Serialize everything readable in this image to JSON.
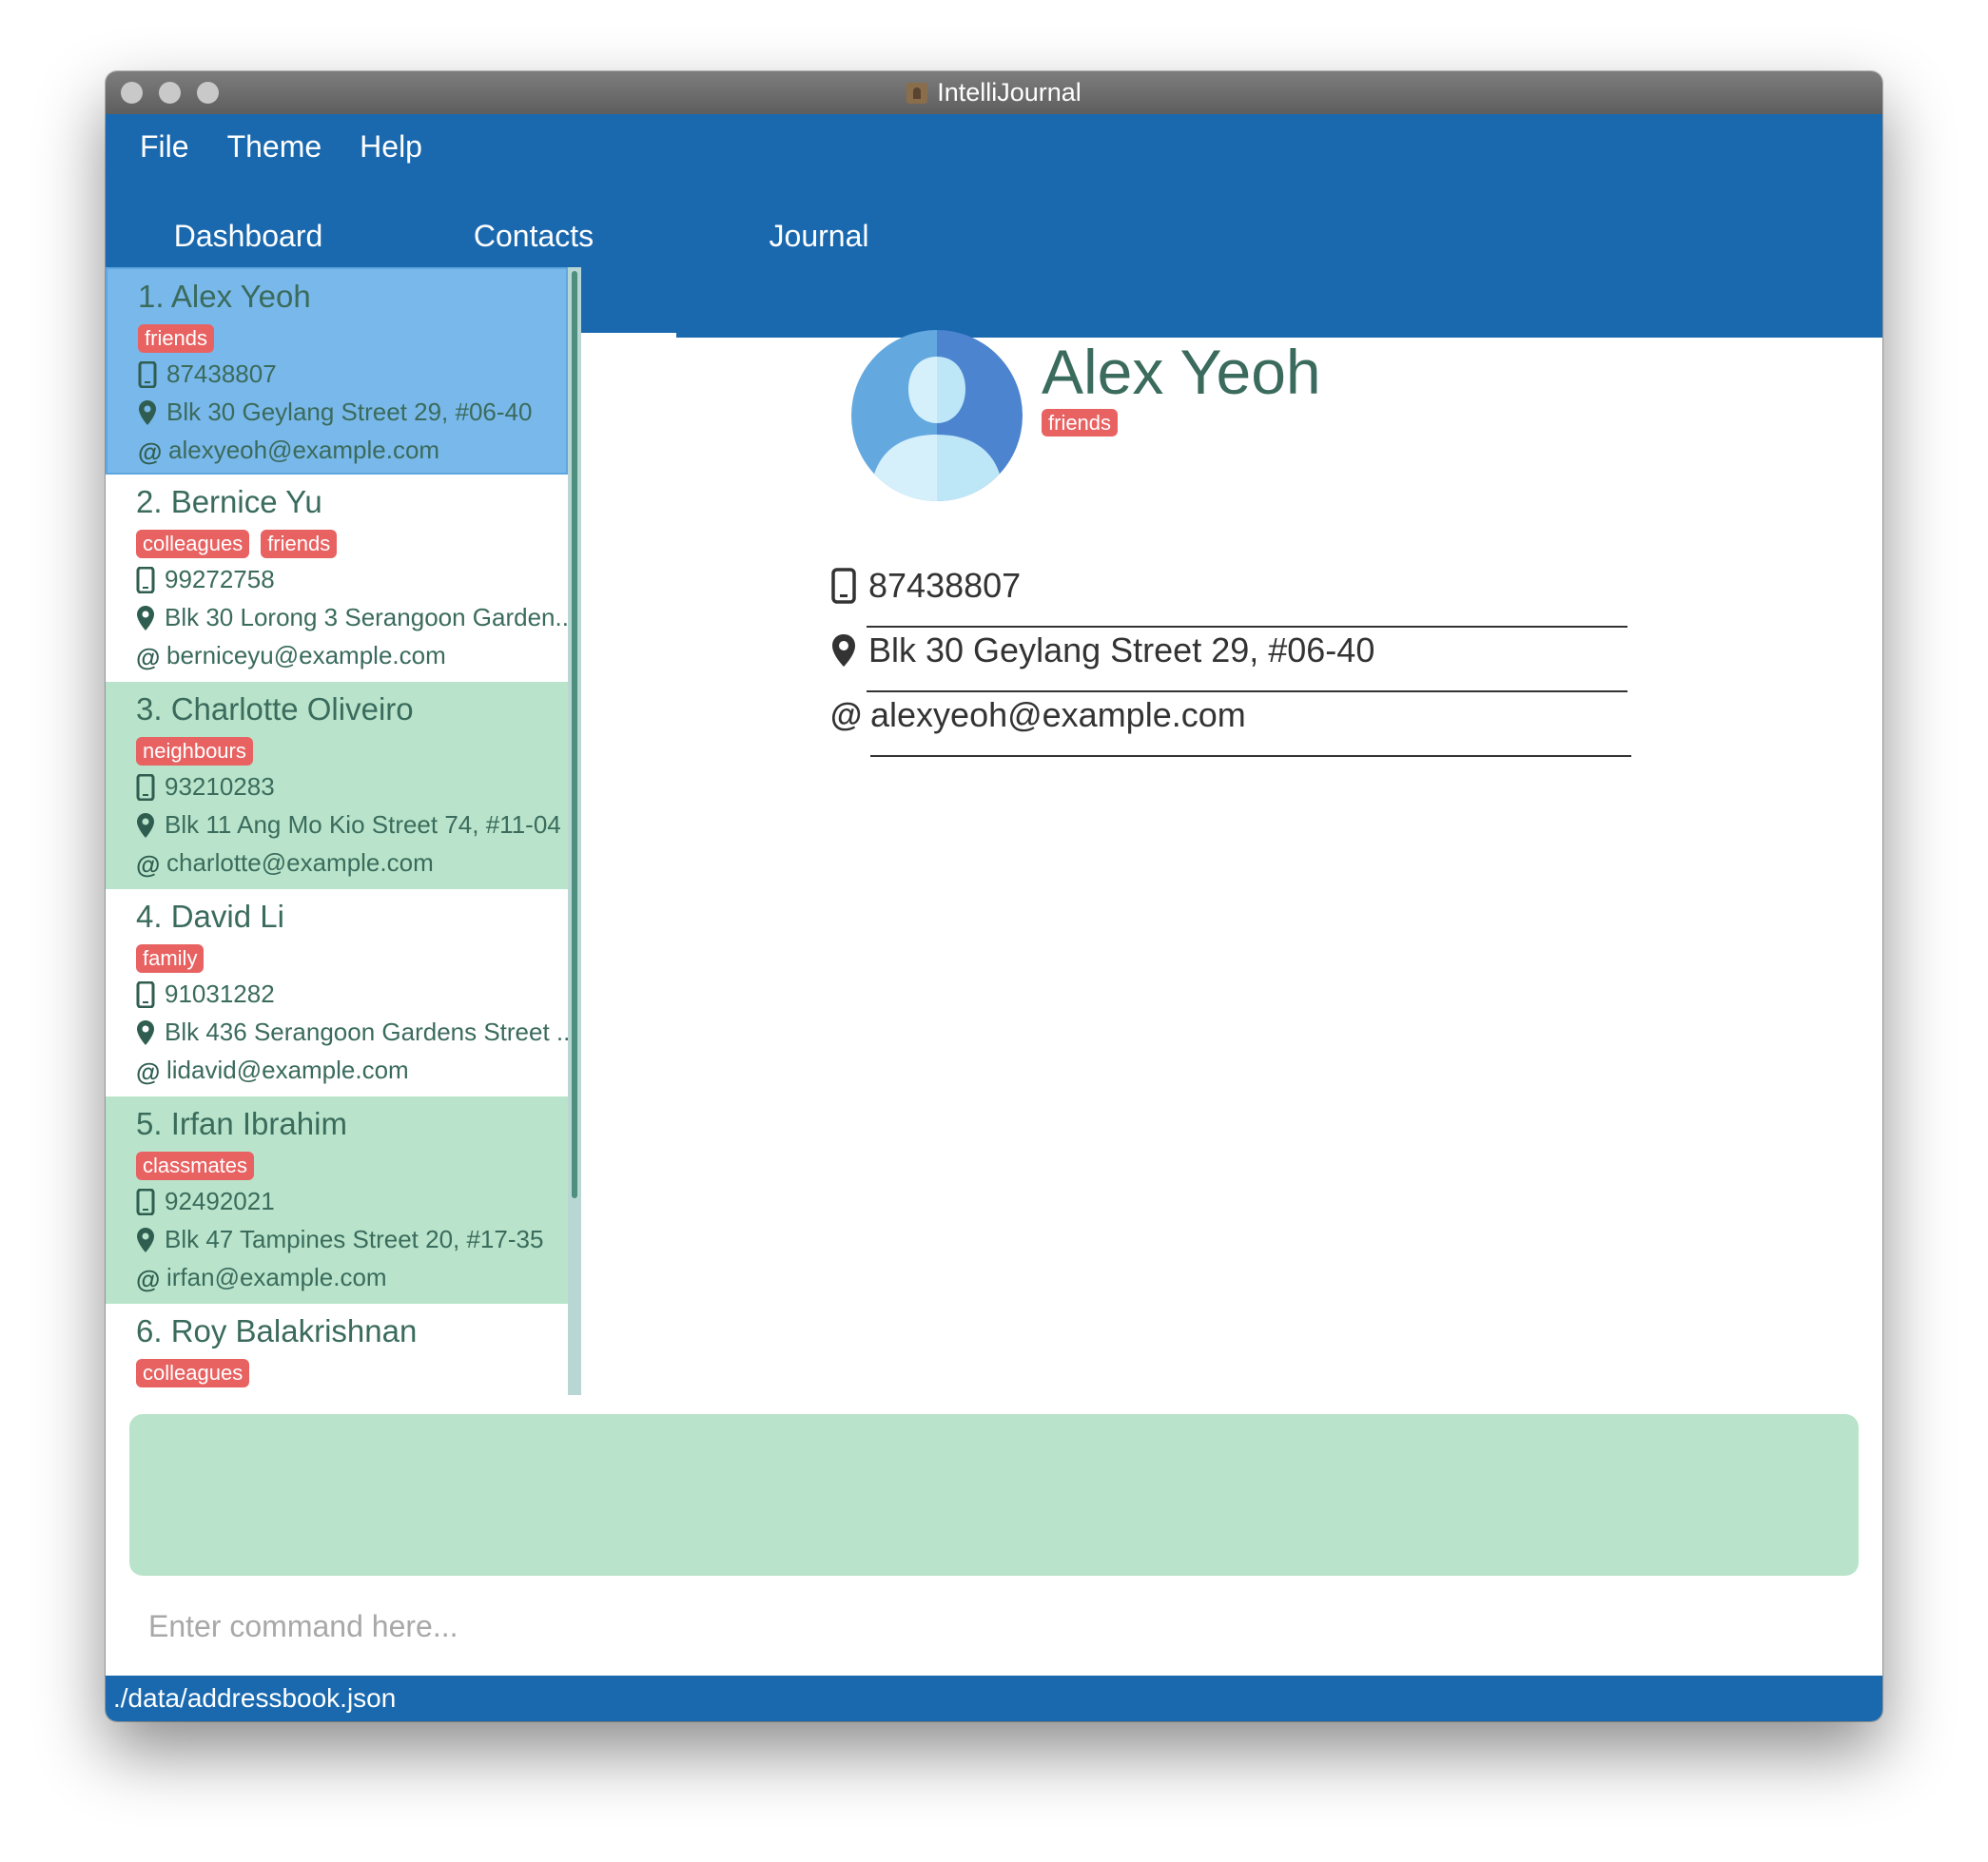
{
  "window": {
    "title": "IntelliJournal"
  },
  "menu": {
    "file": "File",
    "theme": "Theme",
    "help": "Help"
  },
  "tabs": [
    {
      "label": "Dashboard"
    },
    {
      "label": "Contacts"
    },
    {
      "label": "Journal"
    }
  ],
  "contacts": [
    {
      "name": "1.  Alex Yeoh",
      "tags": [
        "friends"
      ],
      "phone": "87438807",
      "address": "Blk 30 Geylang Street 29, #06-40",
      "email": "alexyeoh@example.com"
    },
    {
      "name": "2.  Bernice Yu",
      "tags": [
        "colleagues",
        "friends"
      ],
      "phone": "99272758",
      "address": "Blk 30 Lorong 3 Serangoon Garden...",
      "email": "berniceyu@example.com"
    },
    {
      "name": "3.  Charlotte Oliveiro",
      "tags": [
        "neighbours"
      ],
      "phone": "93210283",
      "address": "Blk 11 Ang Mo Kio Street 74, #11-04",
      "email": "charlotte@example.com"
    },
    {
      "name": "4.  David Li",
      "tags": [
        "family"
      ],
      "phone": "91031282",
      "address": "Blk 436 Serangoon Gardens Street ...",
      "email": "lidavid@example.com"
    },
    {
      "name": "5.  Irfan Ibrahim",
      "tags": [
        "classmates"
      ],
      "phone": "92492021",
      "address": "Blk 47 Tampines Street 20, #17-35",
      "email": "irfan@example.com"
    },
    {
      "name": "6.  Roy Balakrishnan",
      "tags": [
        "colleagues"
      ],
      "phone": "",
      "address": "",
      "email": ""
    }
  ],
  "detail": {
    "name": "Alex Yeoh",
    "tag": "friends",
    "phone": "87438807",
    "address": "Blk 30 Geylang Street 29, #06-40",
    "email": "alexyeoh@example.com"
  },
  "command": {
    "placeholder": "Enter command here..."
  },
  "status": {
    "path": "./data/addressbook.json"
  },
  "colors": {
    "primary": "#1a69af",
    "selected": "#79b8ea",
    "alternate": "#b9e4cb",
    "tag": "#e86262",
    "text": "#3a6b5c"
  }
}
